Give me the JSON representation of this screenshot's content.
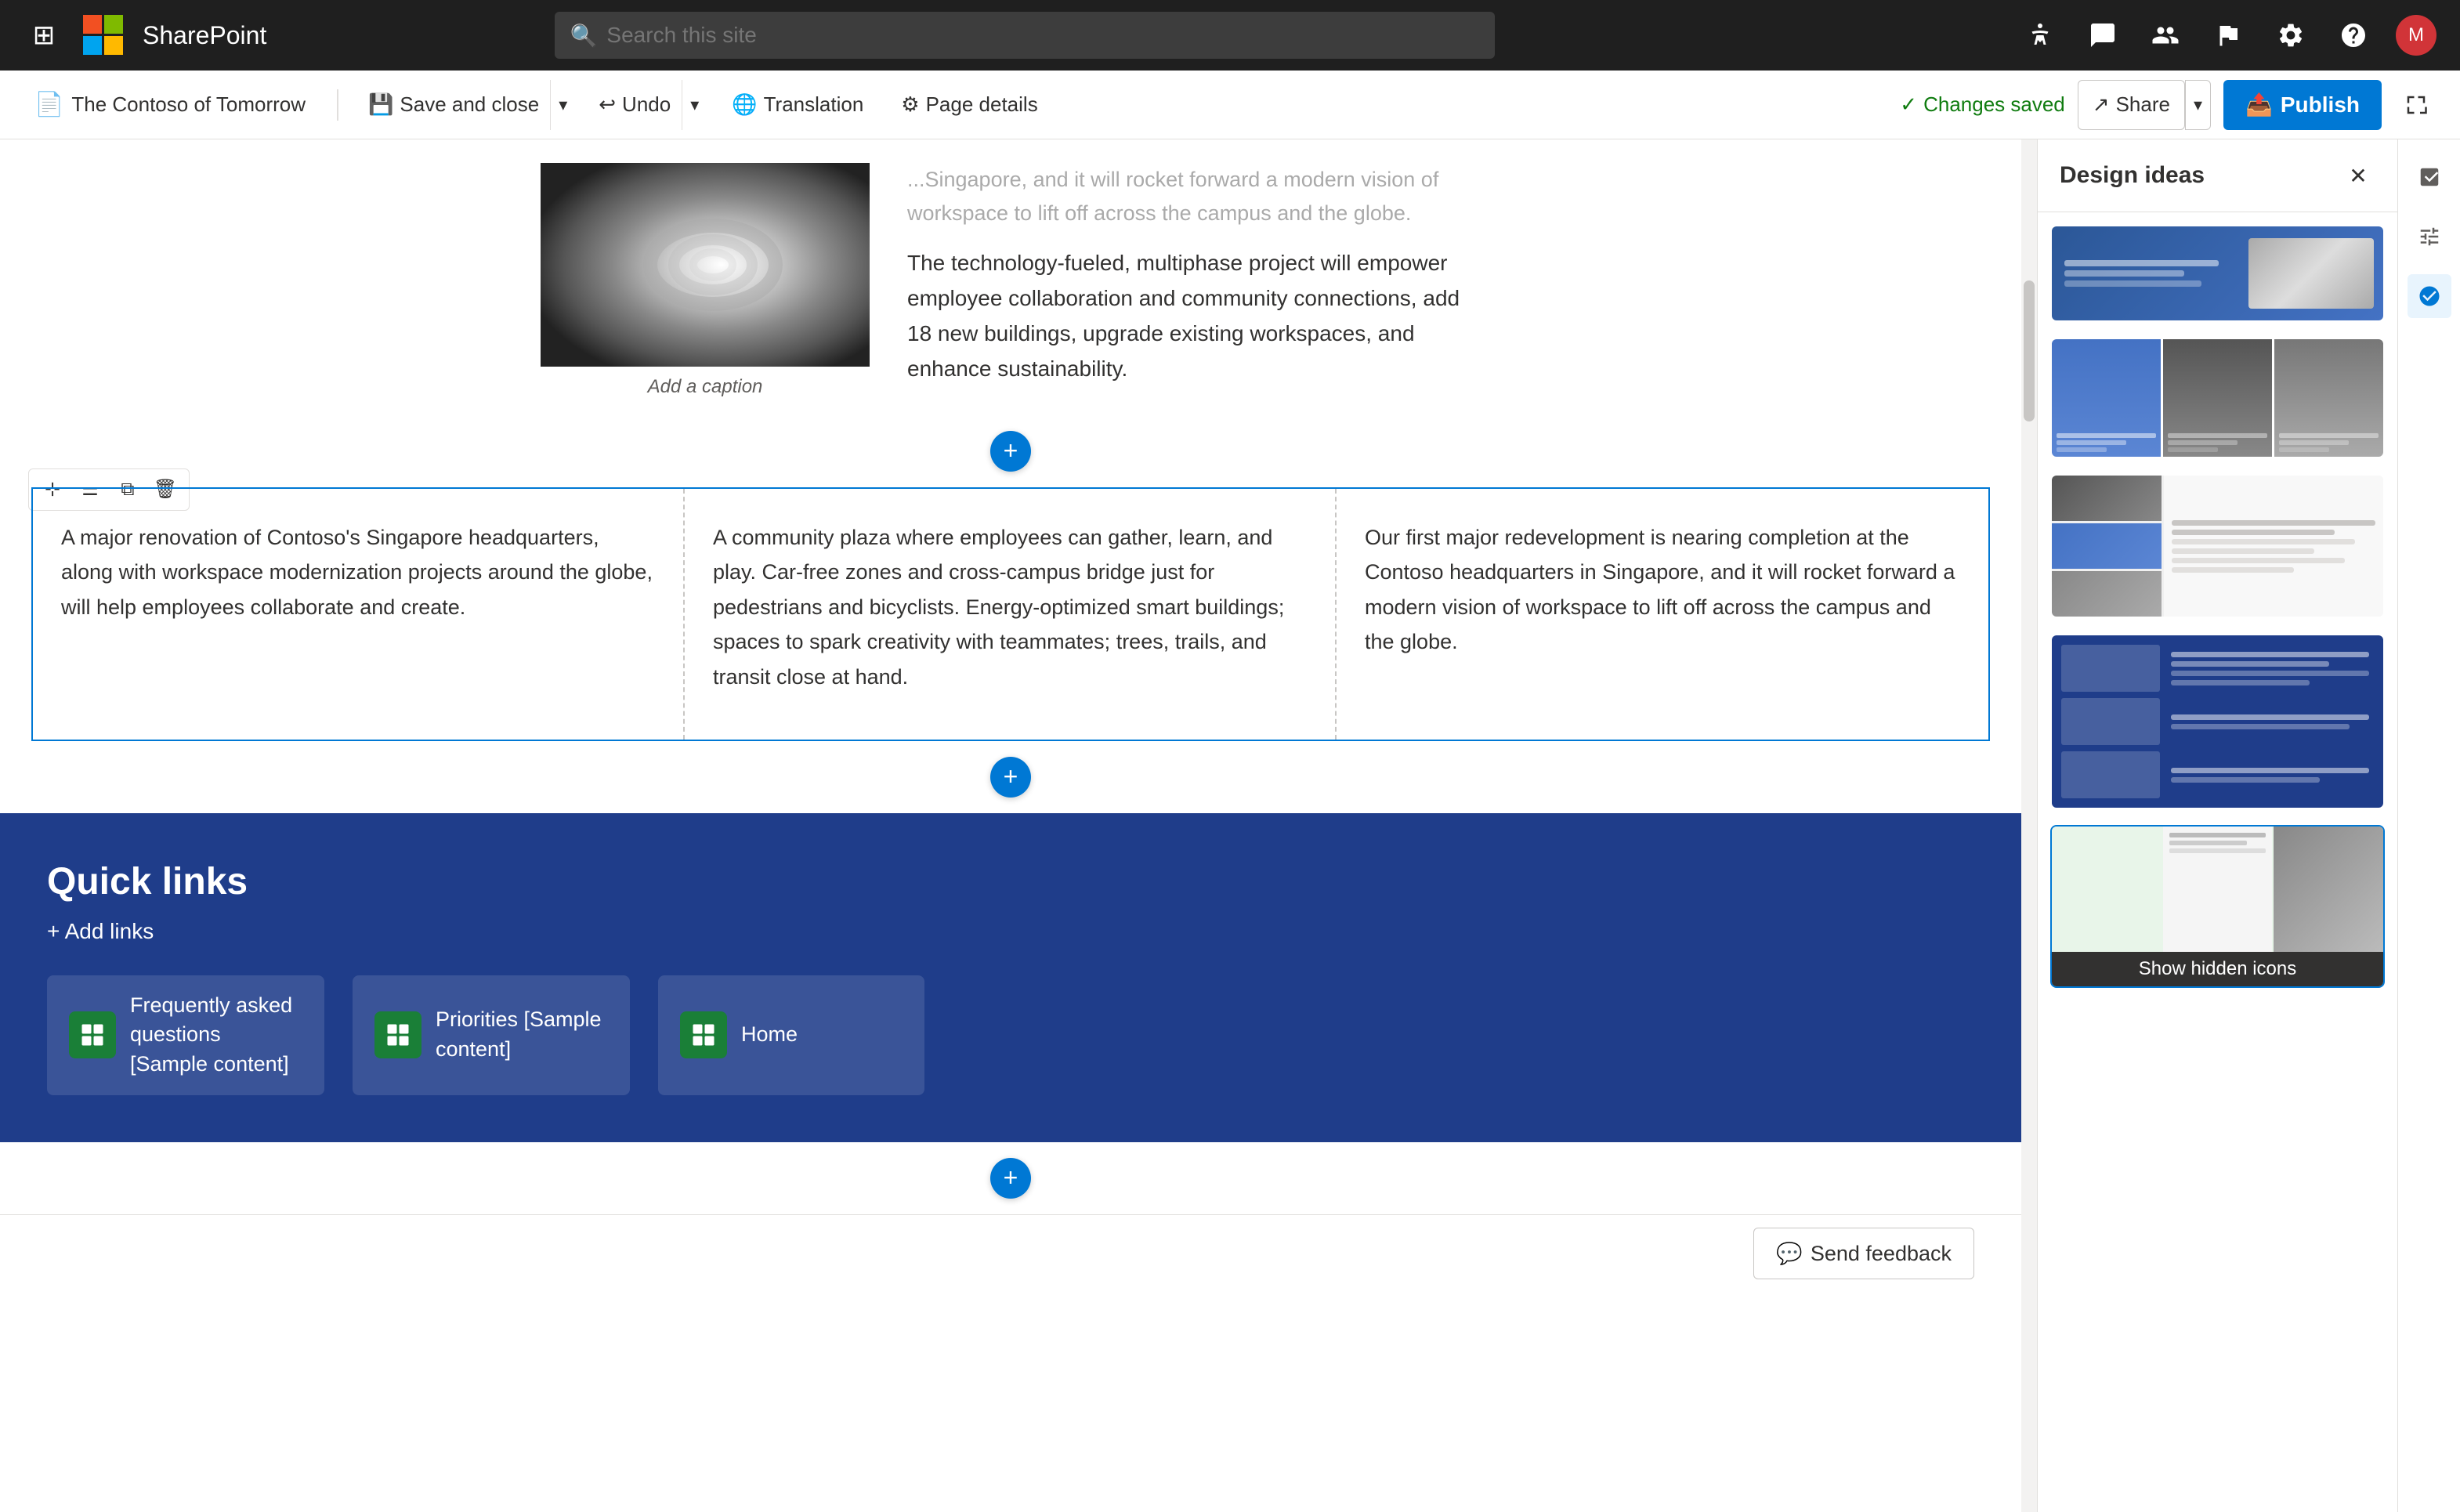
{
  "topnav": {
    "app_name": "SharePoint",
    "search_placeholder": "Search this site",
    "icons": [
      "grid-icon",
      "help-icon",
      "feedback-icon",
      "people-icon",
      "flag-icon",
      "settings-icon",
      "question-icon"
    ]
  },
  "toolbar": {
    "tab_label": "The Contoso of Tomorrow",
    "save_close_label": "Save and close",
    "undo_label": "Undo",
    "translation_label": "Translation",
    "page_details_label": "Page details",
    "changes_saved_label": "Changes saved",
    "share_label": "Share",
    "publish_label": "Publish"
  },
  "design_panel": {
    "title": "Design ideas",
    "close_label": "×"
  },
  "content": {
    "text1": "campus and the globe.",
    "text2": "The technology-fueled, multiphase project will empower employee collaboration and community connections, add 18 new buildings, upgrade existing workspaces, and enhance sustainability.",
    "image_caption": "Add a caption",
    "col1": "A major renovation of Contoso's Singapore headquarters, along with workspace modernization projects around the globe, will help employees collaborate and create.",
    "col2": "A community plaza where employees can gather, learn, and play. Car-free zones and cross-campus bridge just for pedestrians and bicyclists. Energy-optimized smart buildings; spaces to spark creativity with teammates; trees, trails, and transit close at hand.",
    "col3": "Our first major redevelopment is nearing completion at the Contoso headquarters in Singapore, and it will rocket forward a modern vision of workspace to lift off across the campus and the globe."
  },
  "quick_links": {
    "title": "Quick links",
    "add_links_label": "+ Add links",
    "links": [
      {
        "label": "Frequently asked questions [Sample content]"
      },
      {
        "label": "Priorities [Sample content]"
      },
      {
        "label": "Home"
      }
    ]
  },
  "feedback": {
    "label": "Send feedback"
  },
  "tooltip": {
    "show_hidden": "Show hidden icons"
  }
}
